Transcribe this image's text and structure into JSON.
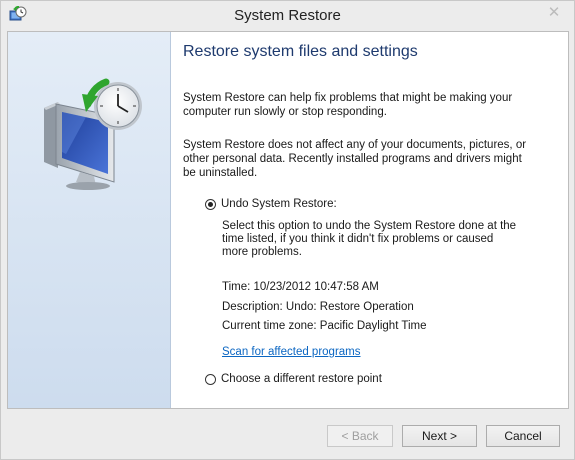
{
  "window": {
    "title": "System Restore",
    "close_glyph": "✕"
  },
  "header": {
    "heading": "Restore system files and settings"
  },
  "intro": {
    "paragraph1": "System Restore can help fix problems that might be making your computer run slowly or stop responding.",
    "paragraph2": "System Restore does not affect any of your documents, pictures, or other personal data. Recently installed programs and drivers might be uninstalled."
  },
  "options": {
    "undo": {
      "label": "Undo System Restore:",
      "selected": true,
      "description": "Select this option to undo the System Restore done at the time listed, if you think it didn't fix problems or caused more problems.",
      "time": "Time: 10/23/2012 10:47:58 AM",
      "restore_description": "Description: Undo: Restore Operation",
      "time_zone": "Current time zone: Pacific Daylight Time",
      "link": "Scan for affected programs"
    },
    "different": {
      "label": "Choose a different restore point",
      "selected": false
    }
  },
  "buttons": {
    "back": "< Back",
    "next": "Next >",
    "cancel": "Cancel"
  },
  "icons": {
    "title": "system-restore-icon",
    "hero": "system-restore-clock-monitor-icon"
  },
  "colors": {
    "heading": "#1e3a6e",
    "link": "#0b66c2",
    "side_panel": "#dbe6f3"
  }
}
